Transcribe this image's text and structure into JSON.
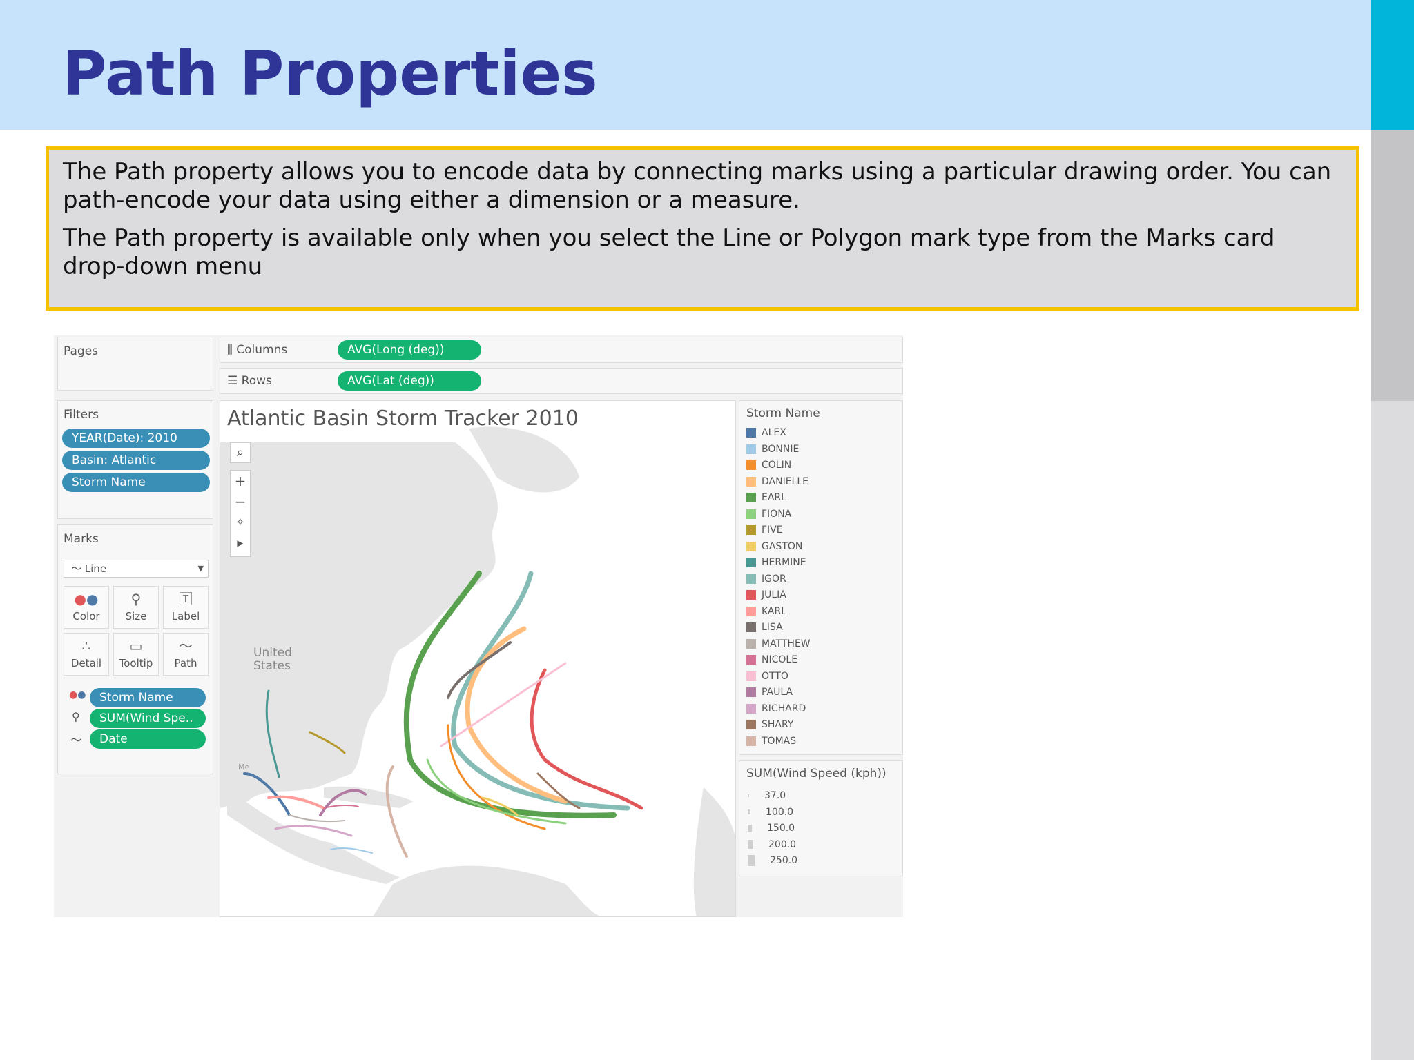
{
  "page": {
    "title": "Path Properties",
    "paragraphs": [
      "The Path property allows you to encode data by connecting marks using a particular drawing order. You can path-encode your data using either a dimension or a measure.",
      "The Path property is available only when you select the Line or Polygon mark type from the Marks card drop-down menu"
    ]
  },
  "colors": {
    "header_bg": "#c7e3fb",
    "title": "#2e3597",
    "box_border": "#f5c200",
    "box_bg": "#dcdcde",
    "accent_strip": "#00b5d9",
    "pill_blue": "#3a8fb7",
    "pill_green": "#15b371"
  },
  "tableau": {
    "pages_label": "Pages",
    "columns": {
      "label": "Columns",
      "pill": "AVG(Long (deg))"
    },
    "rows": {
      "label": "Rows",
      "pill": "AVG(Lat (deg))"
    },
    "filters": {
      "label": "Filters",
      "pills": [
        "YEAR(Date): 2010",
        "Basin: Atlantic",
        "Storm Name"
      ]
    },
    "marks": {
      "label": "Marks",
      "type": "Line",
      "buttons": [
        {
          "label": "Color",
          "icon": "color-dots-icon"
        },
        {
          "label": "Size",
          "icon": "size-icon"
        },
        {
          "label": "Label",
          "icon": "label-icon"
        },
        {
          "label": "Detail",
          "icon": "detail-icon"
        },
        {
          "label": "Tooltip",
          "icon": "tooltip-icon"
        },
        {
          "label": "Path",
          "icon": "path-icon"
        }
      ],
      "fields": [
        {
          "pill": "Storm Name",
          "icon": "color-dots-icon"
        },
        {
          "pill": "SUM(Wind Spe..",
          "icon": "size-icon"
        },
        {
          "pill": "Date",
          "icon": "path-icon"
        }
      ]
    },
    "viz": {
      "title": "Atlantic Basin Storm Tracker 2010",
      "map_labels": {
        "country": "United\nStates",
        "mexico_abbrev": "Me"
      },
      "map_controls": [
        "search-icon",
        "zoom-in-icon",
        "zoom-out-icon",
        "pin-icon",
        "expand-icon"
      ]
    },
    "storm_legend": {
      "title": "Storm Name",
      "items": [
        {
          "name": "ALEX",
          "color": "#4e79a7"
        },
        {
          "name": "BONNIE",
          "color": "#a0cbe8"
        },
        {
          "name": "COLIN",
          "color": "#f28e2b"
        },
        {
          "name": "DANIELLE",
          "color": "#ffbe7d"
        },
        {
          "name": "EARL",
          "color": "#59a14f"
        },
        {
          "name": "FIONA",
          "color": "#8cd17d"
        },
        {
          "name": "FIVE",
          "color": "#b6992d"
        },
        {
          "name": "GASTON",
          "color": "#f1ce63"
        },
        {
          "name": "HERMINE",
          "color": "#499894"
        },
        {
          "name": "IGOR",
          "color": "#86bcb6"
        },
        {
          "name": "JULIA",
          "color": "#e15759"
        },
        {
          "name": "KARL",
          "color": "#ff9d9a"
        },
        {
          "name": "LISA",
          "color": "#79706e"
        },
        {
          "name": "MATTHEW",
          "color": "#bab0ac"
        },
        {
          "name": "NICOLE",
          "color": "#d37295"
        },
        {
          "name": "OTTO",
          "color": "#fabfd2"
        },
        {
          "name": "PAULA",
          "color": "#b07aa1"
        },
        {
          "name": "RICHARD",
          "color": "#d4a6c8"
        },
        {
          "name": "SHARY",
          "color": "#9d7660"
        },
        {
          "name": "TOMAS",
          "color": "#d7b5a6"
        }
      ]
    },
    "size_legend": {
      "title": "SUM(Wind Speed (kph))",
      "values": [
        "37.0",
        "100.0",
        "150.0",
        "200.0",
        "250.0"
      ]
    }
  }
}
